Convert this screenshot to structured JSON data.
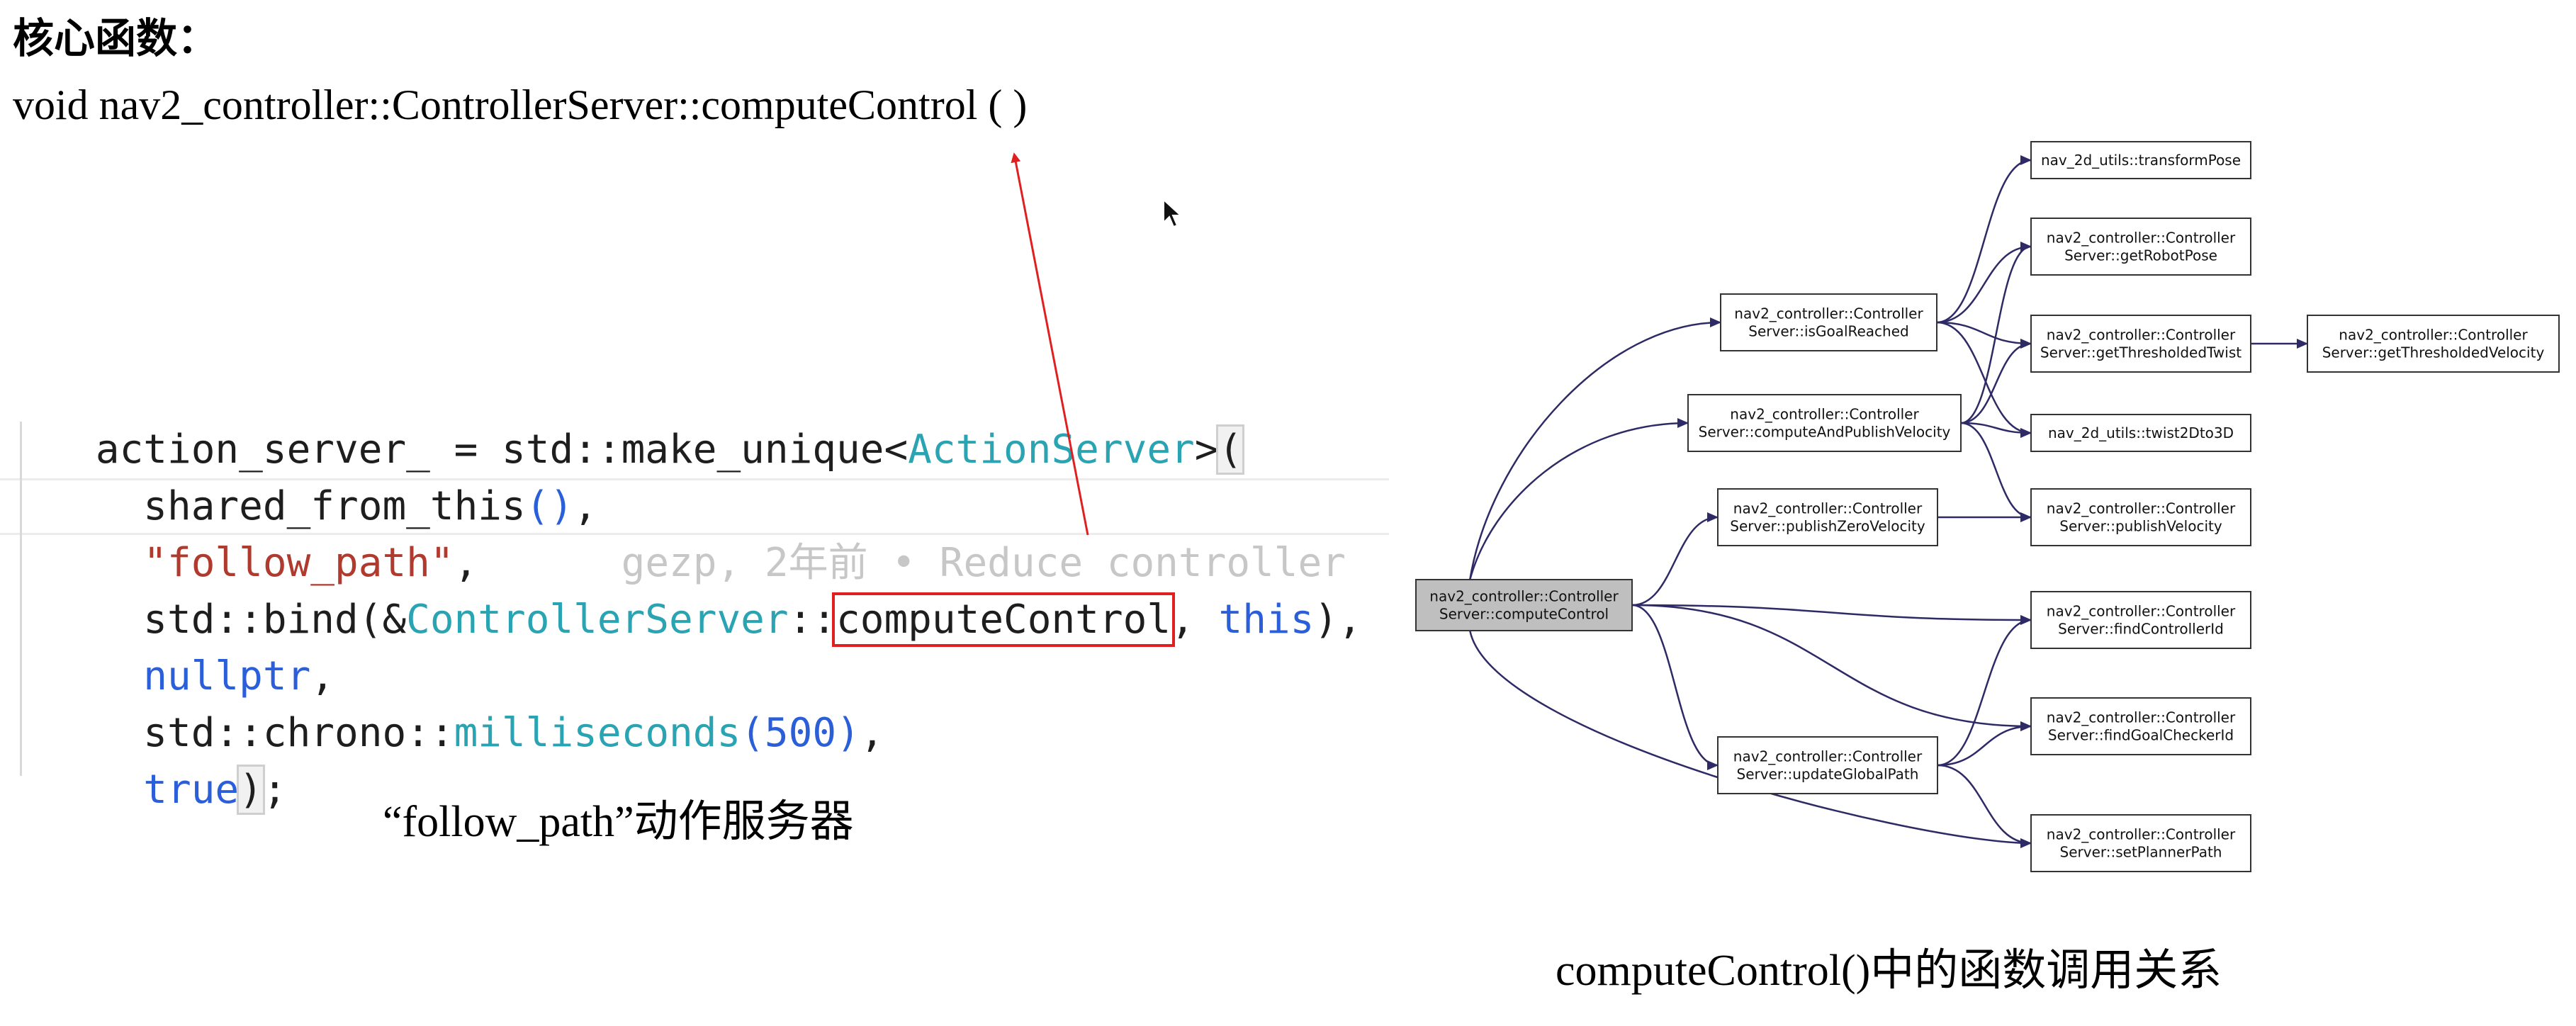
{
  "heading": "核心函数：",
  "signature": "void nav2_controller::ControllerServer::computeControl ( )",
  "code": {
    "line1": {
      "a": "action_server_ = std::make_unique<",
      "type": "ActionServer",
      "b": ">",
      "bracket": "("
    },
    "line2": {
      "a": "  shared_from_this",
      "paren": "()",
      "b": ","
    },
    "line3": {
      "str": "  \"follow_path\"",
      "b": ",",
      "ghost": "      gezp, 2年前 • Reduce controller"
    },
    "line4": {
      "a": "  std::bind(&",
      "type": "ControllerServer",
      "b": "::",
      "boxed": "computeControl",
      "c": ", ",
      "kw": "this",
      "d": "),"
    },
    "line5": {
      "kw": "  nullptr",
      "b": ","
    },
    "line6": {
      "a": "  std::chrono::",
      "type": "milliseconds",
      "paren_open": "(",
      "num": "500",
      "paren_close": ")",
      "b": ","
    },
    "line7": {
      "kw": "  true",
      "bracket": ")",
      "b": ";"
    }
  },
  "code_caption": "“follow_path”动作服务器",
  "graph_caption": "computeControl()中的函数调用关系",
  "colors": {
    "edge": "#2e2a66",
    "root_fill": "#bfbfbf",
    "annotation_arrow": "#e02020",
    "box_border": "#333333"
  },
  "graph": {
    "nodes": [
      {
        "id": "root",
        "lines": [
          "nav2_controller::Controller",
          "Server::computeControl"
        ]
      },
      {
        "id": "isGoalReached",
        "lines": [
          "nav2_controller::Controller",
          "Server::isGoalReached"
        ]
      },
      {
        "id": "computeAndPublishVelocity",
        "lines": [
          "nav2_controller::Controller",
          "Server::computeAndPublishVelocity"
        ]
      },
      {
        "id": "publishZeroVelocity",
        "lines": [
          "nav2_controller::Controller",
          "Server::publishZeroVelocity"
        ]
      },
      {
        "id": "updateGlobalPath",
        "lines": [
          "nav2_controller::Controller",
          "Server::updateGlobalPath"
        ]
      },
      {
        "id": "transformPose",
        "lines": [
          "nav_2d_utils::transformPose"
        ]
      },
      {
        "id": "getRobotPose",
        "lines": [
          "nav2_controller::Controller",
          "Server::getRobotPose"
        ]
      },
      {
        "id": "getThresholdedTwist",
        "lines": [
          "nav2_controller::Controller",
          "Server::getThresholdedTwist"
        ]
      },
      {
        "id": "twist2Dto3D",
        "lines": [
          "nav_2d_utils::twist2Dto3D"
        ]
      },
      {
        "id": "publishVelocity",
        "lines": [
          "nav2_controller::Controller",
          "Server::publishVelocity"
        ]
      },
      {
        "id": "findControllerId",
        "lines": [
          "nav2_controller::Controller",
          "Server::findControllerId"
        ]
      },
      {
        "id": "findGoalCheckerId",
        "lines": [
          "nav2_controller::Controller",
          "Server::findGoalCheckerId"
        ]
      },
      {
        "id": "setPlannerPath",
        "lines": [
          "nav2_controller::Controller",
          "Server::setPlannerPath"
        ]
      },
      {
        "id": "getThresholdedVelocity",
        "lines": [
          "nav2_controller::Controller",
          "Server::getThresholdedVelocity"
        ]
      }
    ],
    "edges": [
      [
        "root",
        "isGoalReached"
      ],
      [
        "root",
        "computeAndPublishVelocity"
      ],
      [
        "root",
        "publishZeroVelocity"
      ],
      [
        "root",
        "updateGlobalPath"
      ],
      [
        "root",
        "findControllerId"
      ],
      [
        "root",
        "findGoalCheckerId"
      ],
      [
        "root",
        "setPlannerPath"
      ],
      [
        "isGoalReached",
        "transformPose"
      ],
      [
        "isGoalReached",
        "getRobotPose"
      ],
      [
        "isGoalReached",
        "getThresholdedTwist"
      ],
      [
        "isGoalReached",
        "twist2Dto3D"
      ],
      [
        "computeAndPublishVelocity",
        "getRobotPose"
      ],
      [
        "computeAndPublishVelocity",
        "getThresholdedTwist"
      ],
      [
        "computeAndPublishVelocity",
        "twist2Dto3D"
      ],
      [
        "computeAndPublishVelocity",
        "publishVelocity"
      ],
      [
        "publishZeroVelocity",
        "publishVelocity"
      ],
      [
        "updateGlobalPath",
        "findControllerId"
      ],
      [
        "updateGlobalPath",
        "findGoalCheckerId"
      ],
      [
        "updateGlobalPath",
        "setPlannerPath"
      ],
      [
        "getThresholdedTwist",
        "getThresholdedVelocity"
      ]
    ]
  }
}
